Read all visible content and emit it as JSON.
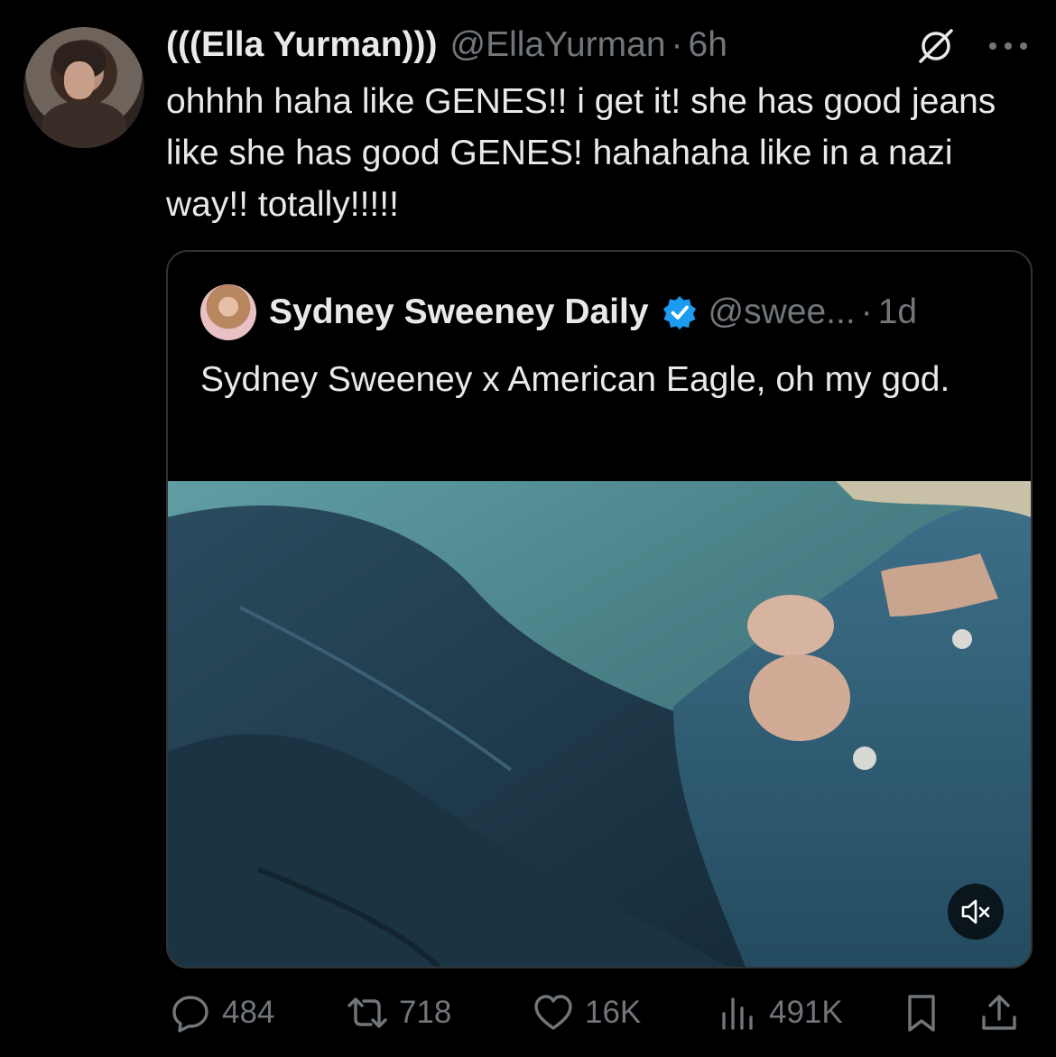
{
  "tweet": {
    "display_name": "(((Ella Yurman)))",
    "handle": "@EllaYurman",
    "separator": "·",
    "time": "6h",
    "text": "ohhhh haha like GENES!! i get it! she has good jeans like she has good GENES! hahahaha like in a nazi way!! totally!!!!!"
  },
  "quote": {
    "display_name": "Sydney Sweeney Daily",
    "handle": "@swee...",
    "separator": "·",
    "time": "1d",
    "verified": true,
    "text": "Sydney Sweeney x American Eagle, oh my god.",
    "media": {
      "muted": true
    }
  },
  "actions": {
    "replies": "484",
    "reposts": "718",
    "likes": "16K",
    "views": "491K"
  },
  "colors": {
    "background": "#000000",
    "text": "#e7e9ea",
    "secondary": "#71767b",
    "border": "#2f3336",
    "verified": "#1d9bf0"
  }
}
